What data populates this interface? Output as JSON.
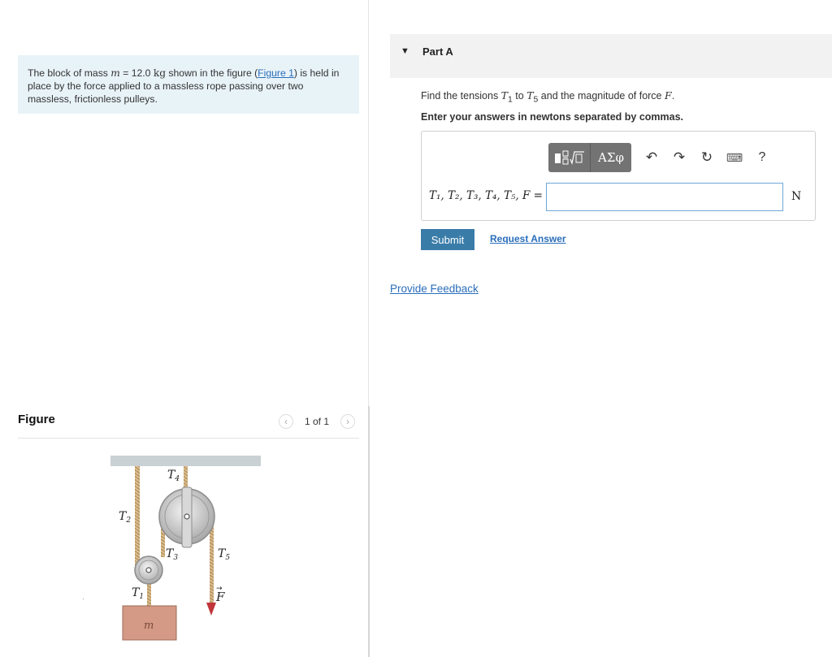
{
  "problem": {
    "text_before_mass": "The block of mass ",
    "mass_var": "m",
    "equals": " = 12.0 ",
    "mass_unit": "kg",
    "text_after_mass": " shown in the figure (",
    "figure_link": "Figure 1",
    "text_end": ") is held in place by the force applied to a massless rope passing over two massless, frictionless pulleys."
  },
  "figure": {
    "title": "Figure",
    "pager_label": "1 of 1",
    "prev_icon": "chevron-left-icon",
    "next_icon": "chevron-right-icon",
    "labels": {
      "t1": "T",
      "t2": "T",
      "t3": "T",
      "t4": "T",
      "t5": "T",
      "force": "F",
      "mass": "m"
    },
    "subscripts": {
      "t1": "1",
      "t2": "2",
      "t3": "3",
      "t4": "4",
      "t5": "5"
    },
    "colors": {
      "rope": "#c9a97a",
      "ceiling": "#c9d1d4",
      "pulley": "#bfbfbf",
      "block": "#d49a86",
      "arrow": "#c0353a"
    }
  },
  "part": {
    "title": "Part A",
    "question_prefix": "Find the tensions ",
    "t_first": "T",
    "t_first_sub": "1",
    "to": " to ",
    "t_last": "T",
    "t_last_sub": "5",
    "question_mid": " and the magnitude of force ",
    "force_var": "F",
    "question_end": ".",
    "instruction": "Enter your answers in newtons separated by commas.",
    "toolbar": {
      "templates_icon": "templates-icon",
      "greek_label": "ΑΣφ",
      "undo_icon": "undo-icon",
      "redo_icon": "redo-icon",
      "reset_icon": "reset-icon",
      "keyboard_icon": "keyboard-icon",
      "help_label": "?"
    },
    "equation_label": "T₁, T₂, T₃, T₄, T₅, F =",
    "answer_value": "",
    "unit": "N",
    "submit_label": "Submit",
    "request_label": "Request Answer"
  },
  "feedback_label": "Provide Feedback"
}
